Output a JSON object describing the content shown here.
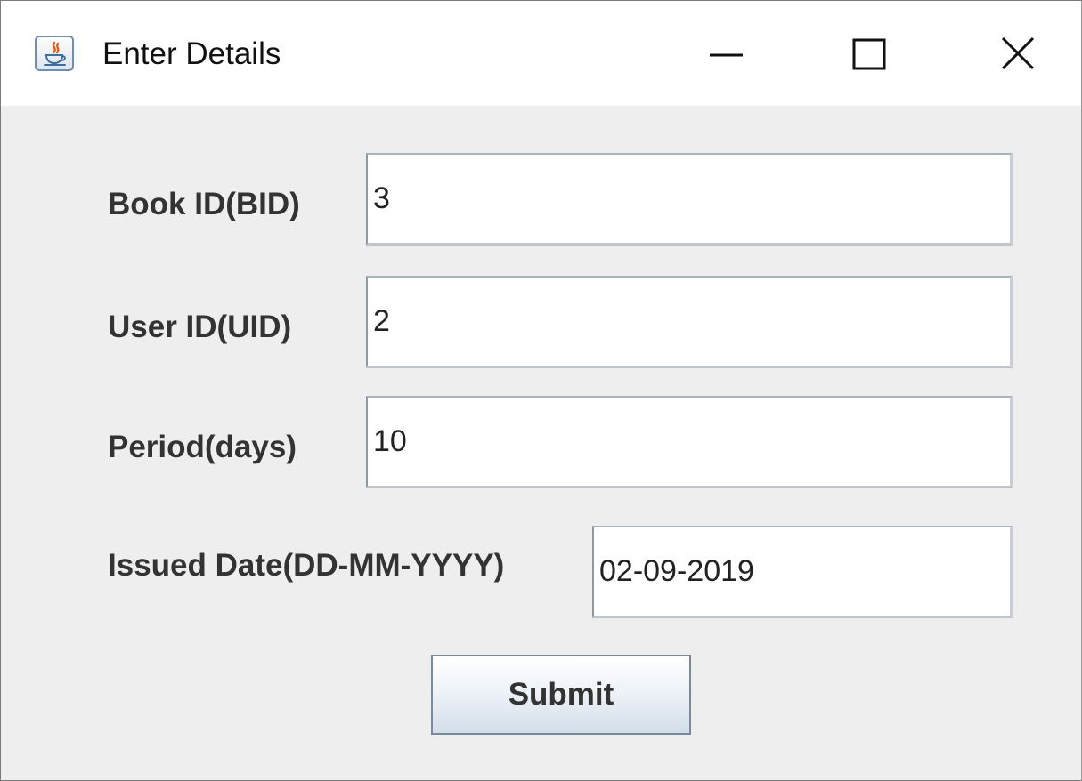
{
  "window": {
    "title": "Enter Details",
    "app_icon": "java-coffee-cup-icon",
    "controls": {
      "minimize_icon": "minimize-icon",
      "maximize_icon": "maximize-icon",
      "close_icon": "close-icon"
    }
  },
  "form": {
    "fields": [
      {
        "label": "Book ID(BID)",
        "value": "3"
      },
      {
        "label": "User ID(UID)",
        "value": "2"
      },
      {
        "label": "Period(days)",
        "value": "10"
      },
      {
        "label": "Issued Date(DD-MM-YYYY)",
        "value": "02-09-2019"
      }
    ],
    "submit_label": "Submit"
  },
  "colors": {
    "titlebar_bg": "#ffffff",
    "content_bg": "#eeeeee",
    "label_text": "#333333",
    "field_bg": "#ffffff",
    "field_border": "#9aa5b0",
    "button_gradient_top": "#ffffff",
    "button_gradient_bottom": "#d3deea",
    "button_border": "#7a8a9c"
  }
}
